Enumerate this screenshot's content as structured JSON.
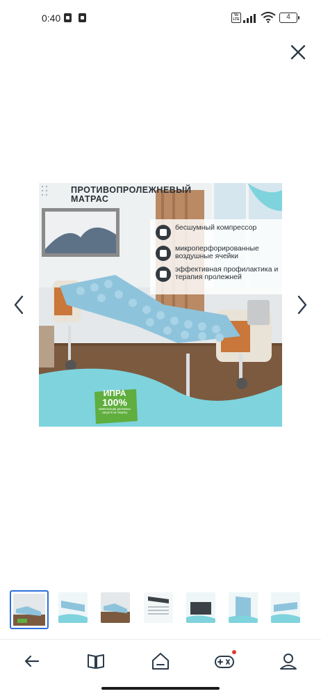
{
  "status_bar": {
    "time": "0:40",
    "volte": "Vo LTE",
    "battery": "4"
  },
  "product_image": {
    "title": "ПРОТИВОПРОЛЕЖНЕВЫЙ МАТРАС",
    "features": [
      {
        "icon": "mute-icon",
        "text": "бесшумный компрессор"
      },
      {
        "icon": "airflow-icon",
        "text": "микроперфорированные воздушные ячейки"
      },
      {
        "icon": "medical-icon",
        "text": "эффективная профилактика и терапия пролежней"
      }
    ],
    "badge": {
      "line1": "ИПРА",
      "line2": "100%",
      "line3": "компенсация денежных средств за покупку"
    }
  },
  "thumbnails": {
    "count": 7,
    "active_index": 0
  },
  "bottom_nav": {
    "items": [
      "back-icon",
      "book-icon",
      "home-icon",
      "gamepad-icon",
      "profile-icon"
    ],
    "notification_color": "#e53935"
  },
  "colors": {
    "accent": "#2f6fdb",
    "mattress": "#8ec3dc",
    "badge_green": "#5fae3e"
  }
}
